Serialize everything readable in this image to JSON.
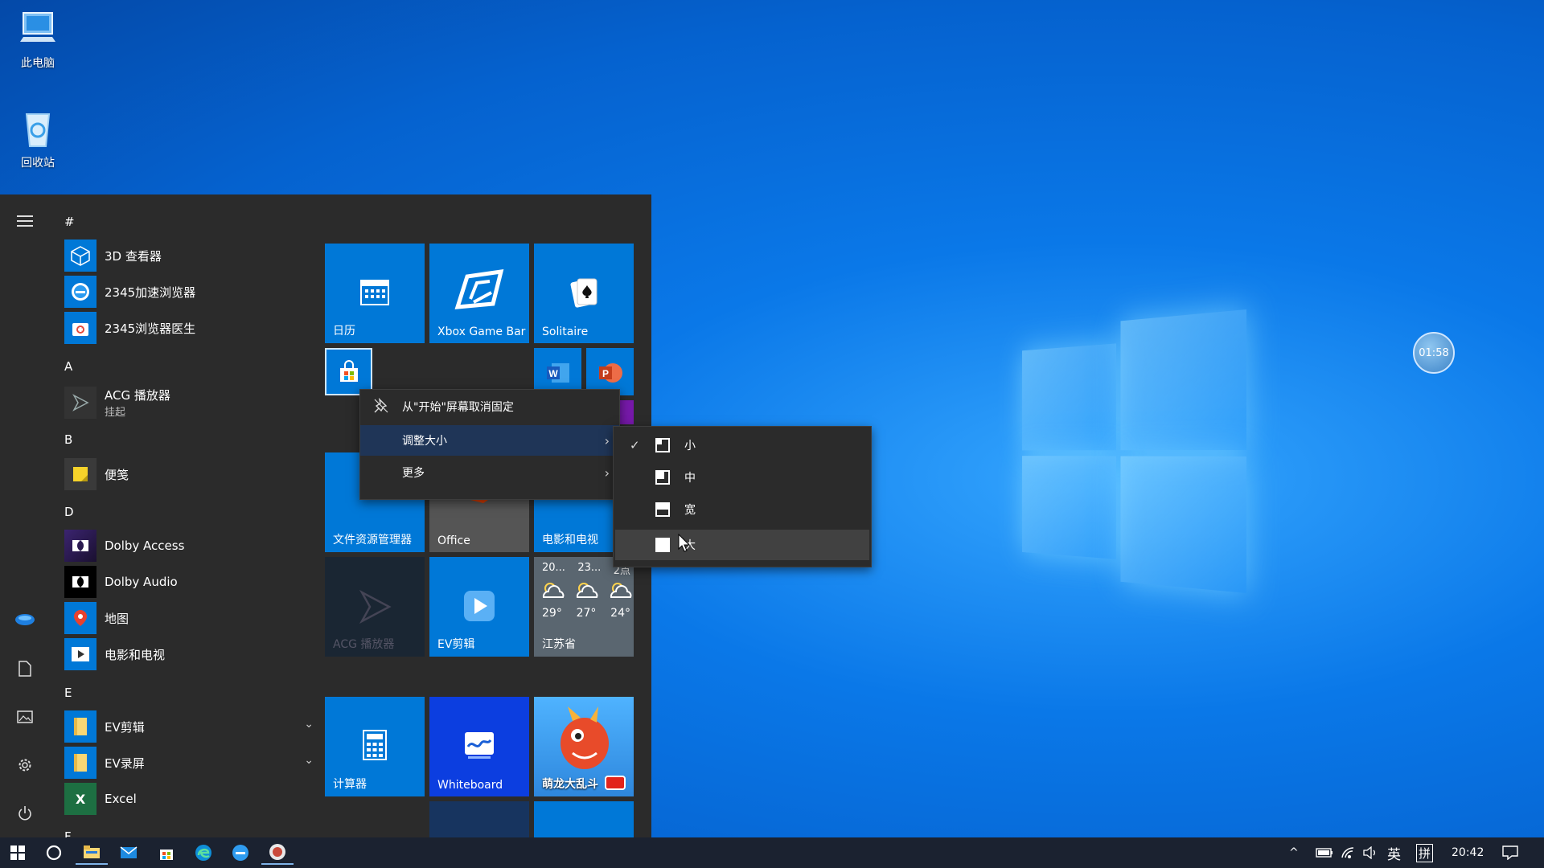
{
  "desktop": {
    "icons": [
      {
        "label": "此电脑",
        "icon": "computer-icon"
      },
      {
        "label": "回收站",
        "icon": "recycle-bin-icon"
      }
    ],
    "timer": "01:58"
  },
  "start_menu": {
    "rail_icons": [
      "hamburger-icon",
      "user-avatar-icon",
      "document-icon",
      "pictures-icon",
      "settings-icon",
      "power-icon"
    ],
    "letters": {
      "hash": "#",
      "a": "A",
      "b": "B",
      "d": "D",
      "e": "E",
      "f": "F"
    },
    "apps": [
      {
        "label": "3D 查看器",
        "icon": "3d-viewer-icon"
      },
      {
        "label": "2345加速浏览器",
        "icon": "browser-icon"
      },
      {
        "label": "2345浏览器医生",
        "icon": "browser-doctor-icon"
      },
      {
        "label": "ACG 播放器",
        "sub": "挂起",
        "icon": "acg-player-icon"
      },
      {
        "label": "便笺",
        "icon": "sticky-notes-icon"
      },
      {
        "label": "Dolby Access",
        "icon": "dolby-icon"
      },
      {
        "label": "Dolby Audio",
        "icon": "dolby-icon"
      },
      {
        "label": "地图",
        "icon": "maps-icon"
      },
      {
        "label": "电影和电视",
        "icon": "movies-icon"
      },
      {
        "label": "EV剪辑",
        "icon": "folder-icon"
      },
      {
        "label": "EV录屏",
        "icon": "folder-icon"
      },
      {
        "label": "Excel",
        "icon": "excel-icon",
        "glyph": "X"
      }
    ],
    "tiles": {
      "calendar": "日历",
      "xbox": "Xbox Game Bar",
      "solitaire": "Solitaire",
      "explorer": "文件资源管理器",
      "office": "Office",
      "movies": "电影和电视",
      "acg": "ACG 播放器",
      "ev_clip": "EV剪辑",
      "weather": {
        "times": [
          "20...",
          "23...",
          "2点"
        ],
        "temps": [
          "29°",
          "27°",
          "24°"
        ],
        "location": "江苏省"
      },
      "calculator": "计算器",
      "whiteboard": "Whiteboard",
      "game": "萌龙大乱斗",
      "word_glyph": "W",
      "ppt_glyph": "P"
    }
  },
  "context_menu": {
    "items": [
      {
        "label": "从\"开始\"屏幕取消固定",
        "icon": "unpin-icon"
      },
      {
        "label": "调整大小",
        "has_submenu": true
      },
      {
        "label": "更多",
        "has_submenu": true
      }
    ],
    "resize_submenu": [
      {
        "label": "小",
        "checked": true
      },
      {
        "label": "中",
        "checked": false
      },
      {
        "label": "宽",
        "checked": false
      },
      {
        "label": "大",
        "checked": false
      }
    ]
  },
  "taskbar": {
    "icons": [
      "windows-start-icon",
      "cortana-search-icon",
      "file-explorer-icon",
      "mail-icon",
      "store-icon",
      "edge-icon",
      "browser-2345-icon",
      "app-icon"
    ],
    "tray": {
      "chevron": "^",
      "ime_lang": "英",
      "ime_mode": "拼",
      "time": "20:42"
    }
  },
  "colors": {
    "accent": "#0078d7",
    "menu_bg": "#2b2b2b",
    "taskbar_bg": "#1b2230"
  }
}
